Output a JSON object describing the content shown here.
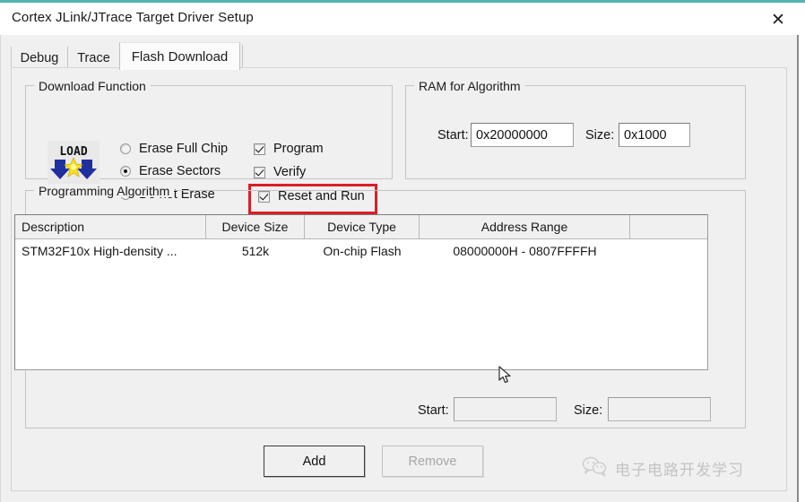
{
  "window": {
    "title": "Cortex JLink/JTrace Target Driver Setup",
    "close_label": "✕",
    "accent_color": "#53b3b0"
  },
  "tabs": [
    {
      "label": "Debug",
      "active": false
    },
    {
      "label": "Trace",
      "active": false
    },
    {
      "label": "Flash Download",
      "active": true
    }
  ],
  "download_function": {
    "legend": "Download Function",
    "icon_name": "load-icon",
    "icon_text": "LOAD",
    "radios": [
      {
        "label": "Erase Full Chip",
        "selected": false
      },
      {
        "label": "Erase Sectors",
        "selected": true
      },
      {
        "label": "Do not Erase",
        "selected": false
      }
    ],
    "checkboxes": [
      {
        "label": "Program",
        "checked": true,
        "highlighted": false
      },
      {
        "label": "Verify",
        "checked": true,
        "highlighted": false
      },
      {
        "label": "Reset and Run",
        "checked": true,
        "highlighted": true
      }
    ],
    "highlight_color": "#d91f26"
  },
  "ram_for_algorithm": {
    "legend": "RAM for Algorithm",
    "start_label": "Start:",
    "start_value": "0x20000000",
    "size_label": "Size:",
    "size_value": "0x1000"
  },
  "programming_algorithm": {
    "legend": "Programming Algorithm",
    "columns": [
      "Description",
      "Device Size",
      "Device Type",
      "Address Range",
      ""
    ],
    "rows": [
      {
        "description": "STM32F10x High-density ...",
        "device_size": "512k",
        "device_type": "On-chip Flash",
        "address_range": "08000000H - 0807FFFFH"
      }
    ],
    "start_label": "Start:",
    "start_value": "",
    "size_label": "Size:",
    "size_value": ""
  },
  "buttons": {
    "add": "Add",
    "remove": "Remove"
  },
  "watermark": {
    "text": "电子电路开发学习",
    "icon_name": "wechat-icon"
  }
}
